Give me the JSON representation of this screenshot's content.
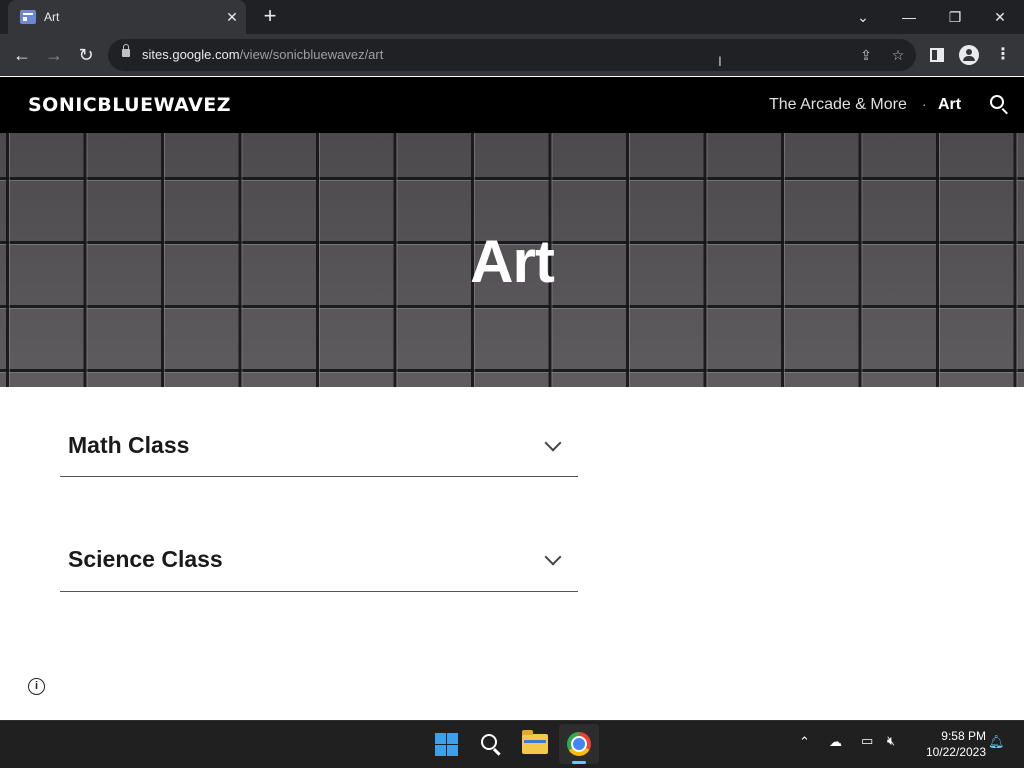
{
  "browser": {
    "tab_title": "Art",
    "tab_close": "✕",
    "new_tab": "+",
    "url_host": "sites.google.com",
    "url_path": "/view/sonicbluewavez/art",
    "window_controls": {
      "dropdown": "⌄",
      "minimize": "—",
      "restore": "❐",
      "close": "✕"
    }
  },
  "site": {
    "logo": "SONICBLUEWAVEZ",
    "nav": {
      "arcade": "The Arcade & More",
      "separator": "·",
      "current": "Art"
    },
    "hero_title": "Art",
    "sections": [
      {
        "title": "Math Class"
      },
      {
        "title": "Science Class"
      }
    ]
  },
  "taskbar": {
    "time": "9:58 PM",
    "date": "10/22/2023"
  },
  "colors": {
    "browser_dark": "#202124",
    "toolbar": "#35363a",
    "site_header": "#000000",
    "hero_tile": "#5a585a",
    "taskbar": "#202020",
    "start_blue": "#3aa0f0"
  }
}
